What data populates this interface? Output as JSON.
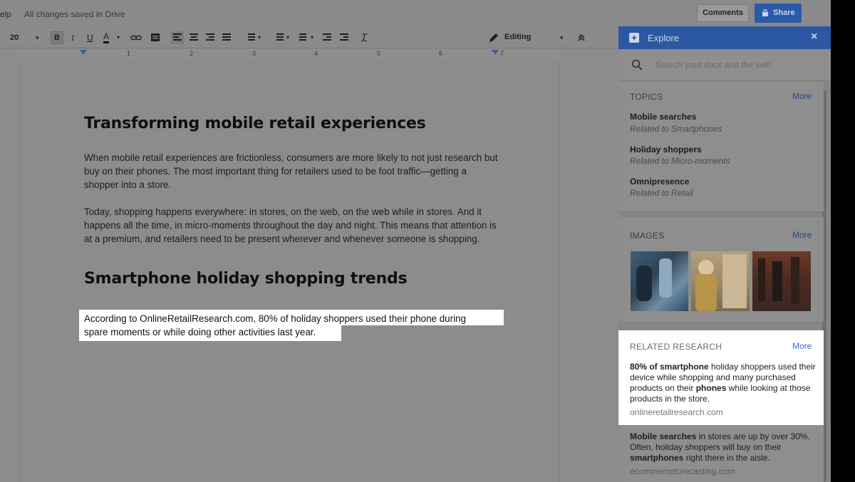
{
  "topbar": {
    "menu_help": "elp",
    "save_status": "All changes saved in Drive",
    "comments_label": "Comments",
    "share_label": "Share"
  },
  "toolbar": {
    "font_size": "20",
    "bold": "B",
    "italic": "I",
    "underline": "U",
    "text_color": "A",
    "editing_mode": "Editing"
  },
  "ruler": {
    "marks": [
      "1",
      "2",
      "3",
      "4",
      "5",
      "6",
      "7"
    ]
  },
  "document": {
    "heading1": "Transforming mobile retail experiences",
    "para1": "When mobile retail experiences are frictionless, consumers are more likely to not just research but buy on their phones. The most important thing for retailers used to be foot traffic—getting a shopper into a store.",
    "para2": "Today, shopping happens everywhere: in stores, on the web, on the web while in stores. And it happens all the time, in micro-moments throughout the day and night. This means that attention is at a premium, and retailers need to be present wherever and whenever someone is shopping.",
    "heading2": "Smartphone holiday shopping trends",
    "para3_line1": "According to OnlineRetailResearch.com, 80% of holiday shoppers used their phone during",
    "para3_line2": "spare moments or while doing other activities last year."
  },
  "explore": {
    "title": "Explore",
    "close": "×",
    "search_placeholder": "Search your docs and the web",
    "topics": {
      "title": "TOPICS",
      "more": "More",
      "items": [
        {
          "name": "Mobile searches",
          "related": "Related to Smartphones"
        },
        {
          "name": "Holiday shoppers",
          "related": "Related to Micro-moments"
        },
        {
          "name": "Omnipresence",
          "related": "Related to Retail"
        }
      ]
    },
    "images": {
      "title": "IMAGES",
      "more": "More"
    },
    "research": {
      "title": "RELATED RESEARCH",
      "more": "More",
      "item1": {
        "b1": "80% of smartphone",
        "t1": " holiday shoppers used their device while shopping and many purchased products on their ",
        "b2": "phones",
        "t2": " while looking at those products in the store.",
        "source": "onlineretailresearch.com"
      },
      "item2": {
        "b1": "Mobile searches",
        "t1": " in stores are up by over 30%. Often, holiday shoppers will buy on their ",
        "b2": "smartphones",
        "t2": " right there in the aisle.",
        "source": "ecommerceforecasting.com"
      }
    }
  }
}
